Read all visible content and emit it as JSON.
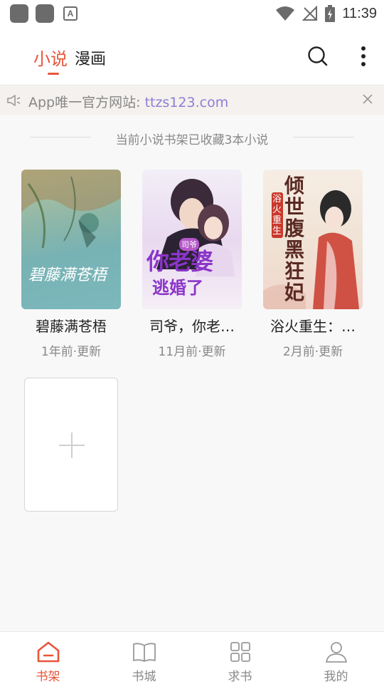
{
  "status_bar": {
    "time": "11:39",
    "app_badge": "A",
    "icons": [
      "app-icon",
      "app-icon",
      "notification-a-icon",
      "wifi-icon",
      "no-signal-icon",
      "battery-charging-icon"
    ]
  },
  "header": {
    "tabs": [
      {
        "label": "小说",
        "active": true
      },
      {
        "label": "漫画",
        "active": false
      }
    ],
    "accent_color": "#e8553a",
    "icons": [
      "search-icon",
      "more-vertical-icon"
    ]
  },
  "notice": {
    "prefix": "App唯一官方网站: ",
    "link": "ttzs123.com",
    "icons": [
      "speaker-icon",
      "close-icon"
    ]
  },
  "shelf": {
    "caption": "当前小说书架已收藏3本小说",
    "books": [
      {
        "title": "碧藤满苍梧",
        "update": "1年前·更新",
        "cover_text": "碧藤满苍梧"
      },
      {
        "title": "司爷，你老…",
        "update": "11月前·更新",
        "cover_text_top": "司爷",
        "cover_text_main": "你老婆",
        "cover_text_sub": "逃婚了"
      },
      {
        "title": "浴火重生：…",
        "update": "2月前·更新",
        "cover_text_main": "倾世腹黑狂妃",
        "cover_text_side": "浴火重生"
      }
    ],
    "add_icon": "plus-icon"
  },
  "bottom_nav": {
    "items": [
      {
        "label": "书架",
        "icon": "home-icon",
        "active": true
      },
      {
        "label": "书城",
        "icon": "book-icon",
        "active": false
      },
      {
        "label": "求书",
        "icon": "grid-icon",
        "active": false
      },
      {
        "label": "我的",
        "icon": "user-icon",
        "active": false
      }
    ]
  }
}
